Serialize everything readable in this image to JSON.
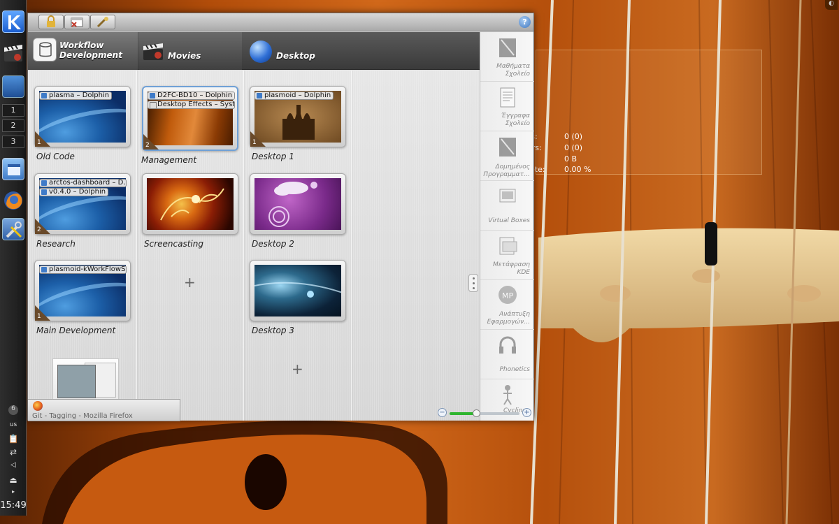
{
  "colors": {
    "wallpaper_wood": "#c2570d",
    "panel_dark": "#1f1f1f",
    "activity_bar": "#474747",
    "content_bg": "#dcdcdc",
    "zoom_green": "#2fb52f"
  },
  "left_panel": {
    "icons": [
      "kde-menu-icon",
      "movies-clapper-icon",
      "show-desktop-icon",
      "dolphin-icon",
      "firefox-icon",
      "tools-icon"
    ],
    "pager": [
      "1",
      "2",
      "3"
    ],
    "tray": {
      "notifications": "6",
      "keyboard_layout": "us"
    },
    "clock": "15:49"
  },
  "toolbar": {
    "buttons": [
      "lock-icon",
      "close-activity-icon",
      "configure-icon"
    ],
    "help": "?"
  },
  "activities": [
    {
      "label_line1": "Workflow",
      "label_line2": "Development",
      "icon": "database-icon"
    },
    {
      "label_line1": "Movies",
      "label_line2": "",
      "icon": "clapper-icon"
    },
    {
      "label_line1": "Desktop",
      "label_line2": "",
      "icon": "globe-icon"
    }
  ],
  "desktops": {
    "col1": [
      {
        "label": "Old Code",
        "count": "1",
        "windows": [
          "plasma – Dolphin"
        ]
      },
      {
        "label": "Research",
        "count": "2",
        "windows": [
          "arctos-dashboard – D…",
          "v0.4.0 – Dolphin"
        ]
      },
      {
        "label": "Main Development",
        "count": "1",
        "windows": [
          "plasmoid-kWorkFlowS…"
        ]
      }
    ],
    "col2": [
      {
        "label": "Management",
        "count": "2",
        "windows": [
          "D2FC-BD10 – Dolphin",
          "Desktop Effects – Syste…"
        ]
      },
      {
        "label": "Screencasting",
        "count": "",
        "windows": []
      }
    ],
    "col3": [
      {
        "label": "Desktop 1",
        "count": "1",
        "windows": [
          "plasmoid – Dolphin"
        ]
      },
      {
        "label": "Desktop 2",
        "count": "",
        "windows": []
      },
      {
        "label": "Desktop 3",
        "count": "",
        "windows": []
      }
    ],
    "add_label": "+"
  },
  "taskbar": {
    "window_title": "Git - Tagging - Mozilla Firefox"
  },
  "right_activities": [
    {
      "label": "Μαθήματα Σχολείο",
      "icon": "book-icon"
    },
    {
      "label": "Έγγραφα Σχολείο",
      "icon": "document-icon"
    },
    {
      "label": "Δομημένος Προγραμματ…",
      "icon": "book-icon"
    },
    {
      "label": "Virtual Boxes",
      "icon": "virtualbox-icon"
    },
    {
      "label": "Μετάφραση KDE",
      "icon": "translate-icon"
    },
    {
      "label": "Ανάπτυξη Εφαρμογών…",
      "icon": "mp-icon"
    },
    {
      "label": "Phonetics",
      "icon": "headphones-icon"
    },
    {
      "label": "Cycling",
      "icon": "figure-icon"
    }
  ],
  "info_widget": {
    "rows": [
      {
        "key": "ders:",
        "value": "0 (0)"
      },
      {
        "key": "chers:",
        "value": "0 (0)"
      },
      {
        "key": ":",
        "value": "0 B"
      },
      {
        "key": "nplete:",
        "value": "0.00 %"
      }
    ]
  },
  "zoom": {
    "level": 0.38
  }
}
